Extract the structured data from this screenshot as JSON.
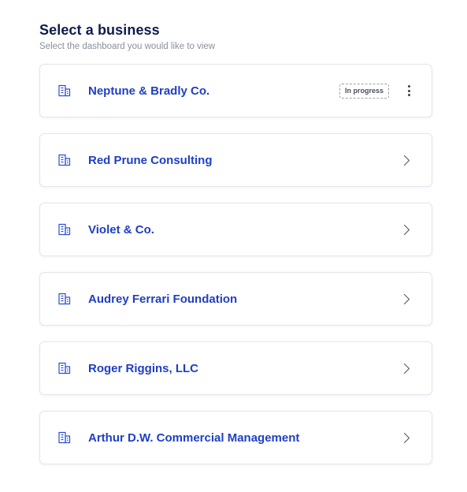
{
  "header": {
    "title": "Select a business",
    "subtitle": "Select the dashboard you would like to view"
  },
  "icons": {
    "row_icon": "building-icon",
    "trailing_default": "chevron-right-icon",
    "trailing_active": "kebab-menu-icon"
  },
  "colors": {
    "title": "#0f1b4c",
    "business_name": "#1e3fc4",
    "icon": "#2d4fd0",
    "subtitle": "#8a8f9c"
  },
  "businesses": [
    {
      "name": "Neptune & Bradly Co.",
      "status": "In progress",
      "trailing": "menu"
    },
    {
      "name": "Red Prune Consulting",
      "status": "",
      "trailing": "chevron"
    },
    {
      "name": "Violet & Co.",
      "status": "",
      "trailing": "chevron"
    },
    {
      "name": "Audrey Ferrari Foundation",
      "status": "",
      "trailing": "chevron"
    },
    {
      "name": "Roger Riggins, LLC",
      "status": "",
      "trailing": "chevron"
    },
    {
      "name": "Arthur D.W. Commercial Management",
      "status": "",
      "trailing": "chevron"
    }
  ]
}
